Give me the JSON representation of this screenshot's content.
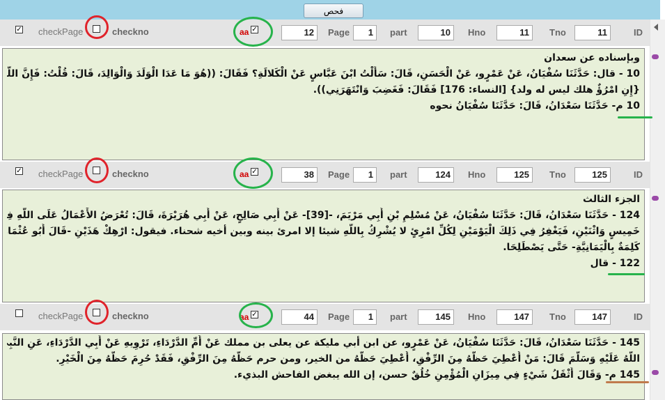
{
  "toolbar": {
    "check_label": "فحص"
  },
  "labels": {
    "checkpage": "checkPage",
    "checkno": "checkno",
    "page": "Page",
    "part": "part",
    "hno": "Hno",
    "tno": "Tno",
    "id": "ID",
    "aa": "aa"
  },
  "records": [
    {
      "checked": true,
      "checkpage_checked": false,
      "aa_checked": true,
      "page": "12",
      "part": "1",
      "hno": "10",
      "tno": "11",
      "id": "11",
      "lines": [
        "وبإسناده عن سعدان",
        "10 - قال: حَدَّثَنَا سُفْيَانُ، عَنْ عَمْرٍو، عَنْ الْحَسَنِ، قَالَ: سَأَلْتُ ابْنَ عَبَّاسٍ عَنْ الْكَلالَةِ؟ فَقَالَ: ((هُوَ مَا عَدَا الْوَلَدَ وَالْوَالِدَ، قَالَ: قُلْتُ: فَإِنَّ اللَّهَ يَقُولُ:",
        "{إِنِ امْرُؤٌ هلك ليس له ولد} [النساء: 176] فَقَالَ: فَغَضِبَ وَانْتَهَرَنِي)).",
        "10 م- حَدَّثَنَا سَعْدَانُ، قَالَ: حَدَّثَنَا سُفْيَانُ نحوه"
      ]
    },
    {
      "checked": true,
      "checkpage_checked": false,
      "aa_checked": true,
      "page": "38",
      "part": "1",
      "hno": "124",
      "tno": "125",
      "id": "125",
      "lines": [
        "الجزء الثالث",
        "124 - حَدَّثَنَا سَعْدَانُ، قَالَ: حَدَّثَنَا سُفْيَانُ، عَنْ مُسْلِمِ بْنِ أَبِي مَرْيَمَ، -[39]- عَنْ أَبِي صَالِحٍ، عَنْ أَبِي هُرَيْرَةَ، قَالَ: تُعْرَضُ الأَعْمَالُ عَلَى اللَّهِ فِي كُلِّ يَوْمِ",
        "خَمِيسٍ وَاثْنَيْنِ، فَيَغْفِرُ فِي ذَلِكَ الْيَوْمَيْنِ لِكُلِّ امْرِئٍ لا يُشْرِكُ بِاللَّهِ شيئا إلا امرئ بينه وبين أخيه شحناء. فيقول: ارْهِكْ هَذَيْنِ -قَالَ أَبُو عُثْمَانَ هِيَ",
        "كَلِمَةٌ بِالْيَمَانِيَّةِ- حَتَّى يَصْطَلِحَا.",
        "122 - قال"
      ]
    },
    {
      "checked": false,
      "checkpage_checked": false,
      "aa_checked": true,
      "page": "44",
      "part": "1",
      "hno": "145",
      "tno": "147",
      "id": "147",
      "lines": [
        "145 - حَدَّثَنَا سَعْدَانُ، قَالَ: حَدَّثَنَا سُفْيَانُ، عَنْ عَمْرٍو، عن ابن أبي مليكة عن يعلى بن مملك عَنْ أُمِّ الدَّرْدَاءِ، تَرْوِيهِ عَنْ أَبِي الدَّرْدَاءِ، عَنِ النَّبِيِّ صَلَّى",
        "اللَّهُ عَلَيْهِ وَسَلَّمَ قَالَ: مَنْ أُعْطِيَ حَظَّهُ مِنَ الرِّفْقِ، أُعْطِيَ حَظَّهُ من الخير، ومن حرم حَظَّهُ مِنَ الرِّفْقِ، فَقَدْ حُرِمَ حَظَّهُ مِنَ الْخَيْرِ.",
        "145 م- وَقَالَ أَثْقَلُ شَيْءٍ فِي مِيزَانِ الْمُؤْمِنِ خُلُقٌ حسن، إن الله يبغض الفاحش البذيء."
      ]
    }
  ],
  "colors": {
    "header_bg": "#e4e4e4",
    "content_bg": "#e8f0d9",
    "topbar_bg": "#9fd3e7",
    "red_marker": "#e0232b",
    "green_marker": "#27b34b",
    "purple_marker": "#9b4aa8",
    "orange_underline": "#c07a4c"
  }
}
